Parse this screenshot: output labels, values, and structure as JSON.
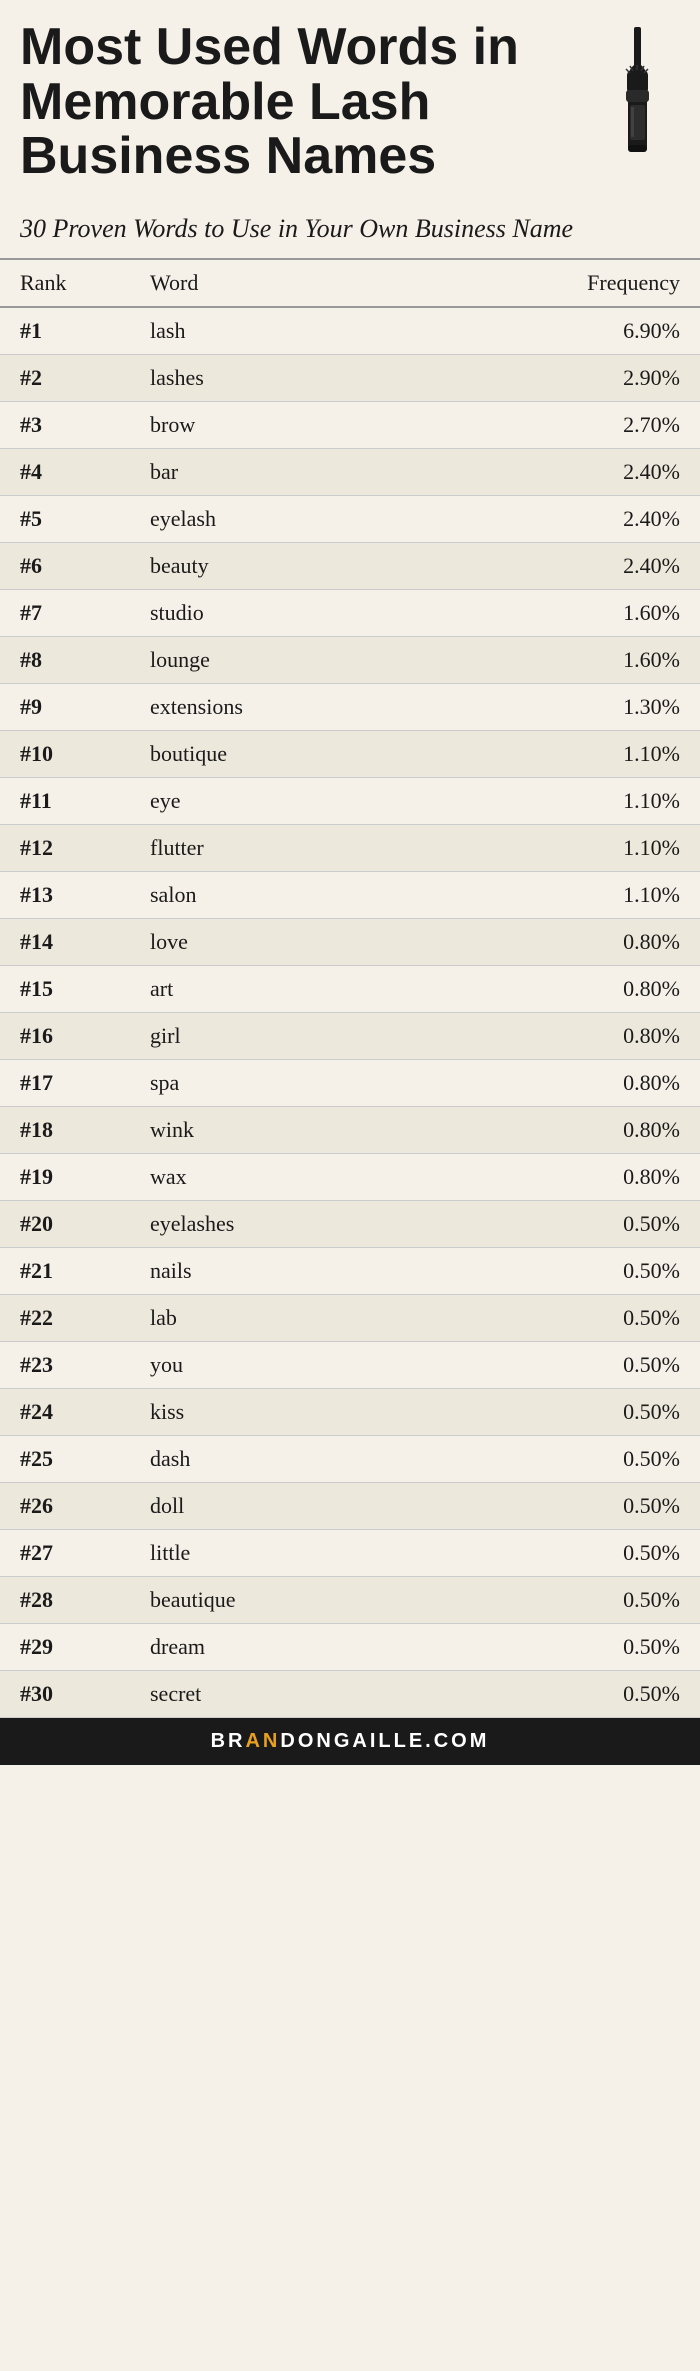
{
  "header": {
    "main_title": "Most Used Words in Memorable Lash Business Names",
    "subtitle": "30 Proven Words to Use in Your Own Business Name"
  },
  "table": {
    "columns": [
      "Rank",
      "Word",
      "Frequency"
    ],
    "rows": [
      {
        "rank": "#1",
        "word": "lash",
        "frequency": "6.90%"
      },
      {
        "rank": "#2",
        "word": "lashes",
        "frequency": "2.90%"
      },
      {
        "rank": "#3",
        "word": "brow",
        "frequency": "2.70%"
      },
      {
        "rank": "#4",
        "word": "bar",
        "frequency": "2.40%"
      },
      {
        "rank": "#5",
        "word": "eyelash",
        "frequency": "2.40%"
      },
      {
        "rank": "#6",
        "word": "beauty",
        "frequency": "2.40%"
      },
      {
        "rank": "#7",
        "word": "studio",
        "frequency": "1.60%"
      },
      {
        "rank": "#8",
        "word": "lounge",
        "frequency": "1.60%"
      },
      {
        "rank": "#9",
        "word": "extensions",
        "frequency": "1.30%"
      },
      {
        "rank": "#10",
        "word": "boutique",
        "frequency": "1.10%"
      },
      {
        "rank": "#11",
        "word": "eye",
        "frequency": "1.10%"
      },
      {
        "rank": "#12",
        "word": "flutter",
        "frequency": "1.10%"
      },
      {
        "rank": "#13",
        "word": "salon",
        "frequency": "1.10%"
      },
      {
        "rank": "#14",
        "word": "love",
        "frequency": "0.80%"
      },
      {
        "rank": "#15",
        "word": "art",
        "frequency": "0.80%"
      },
      {
        "rank": "#16",
        "word": "girl",
        "frequency": "0.80%"
      },
      {
        "rank": "#17",
        "word": "spa",
        "frequency": "0.80%"
      },
      {
        "rank": "#18",
        "word": "wink",
        "frequency": "0.80%"
      },
      {
        "rank": "#19",
        "word": "wax",
        "frequency": "0.80%"
      },
      {
        "rank": "#20",
        "word": "eyelashes",
        "frequency": "0.50%"
      },
      {
        "rank": "#21",
        "word": "nails",
        "frequency": "0.50%"
      },
      {
        "rank": "#22",
        "word": "lab",
        "frequency": "0.50%"
      },
      {
        "rank": "#23",
        "word": "you",
        "frequency": "0.50%"
      },
      {
        "rank": "#24",
        "word": "kiss",
        "frequency": "0.50%"
      },
      {
        "rank": "#25",
        "word": "dash",
        "frequency": "0.50%"
      },
      {
        "rank": "#26",
        "word": "doll",
        "frequency": "0.50%"
      },
      {
        "rank": "#27",
        "word": "little",
        "frequency": "0.50%"
      },
      {
        "rank": "#28",
        "word": "beautique",
        "frequency": "0.50%"
      },
      {
        "rank": "#29",
        "word": "dream",
        "frequency": "0.50%"
      },
      {
        "rank": "#30",
        "word": "secret",
        "frequency": "0.50%"
      }
    ]
  },
  "footer": {
    "brand_text": "BRANDONGAILLE.COM",
    "brand_parts": {
      "br": "BR",
      "an": "AN",
      "don": "DON",
      "gaille": "GAILLE",
      "dot": ".",
      "com": "COM"
    }
  }
}
